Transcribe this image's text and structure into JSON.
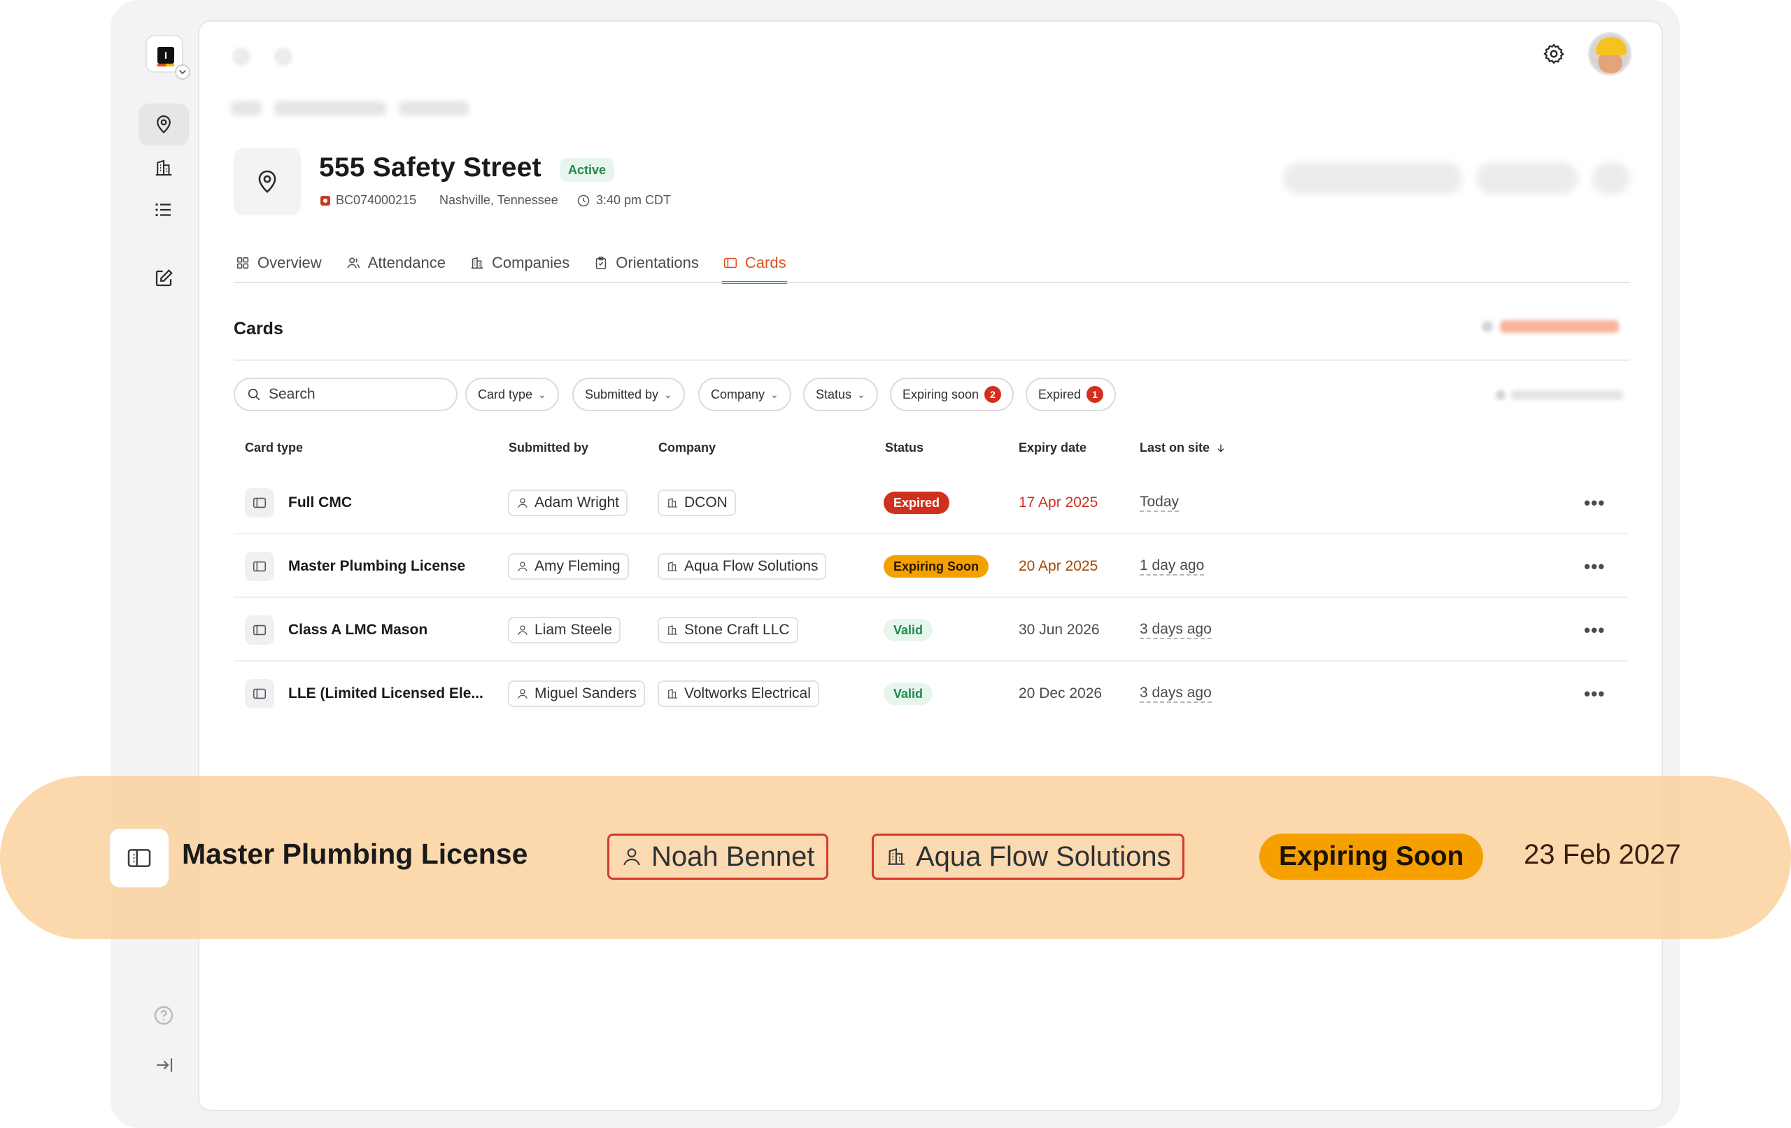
{
  "site": {
    "title": "555 Safety Street",
    "status": "Active",
    "code": "BC074000215",
    "location": "Nashville, Tennessee",
    "time": "3:40 pm CDT"
  },
  "tabs": [
    {
      "label": "Overview",
      "icon": "grid-icon"
    },
    {
      "label": "Attendance",
      "icon": "user-icon"
    },
    {
      "label": "Companies",
      "icon": "building-icon"
    },
    {
      "label": "Orientations",
      "icon": "clipboard-icon"
    },
    {
      "label": "Cards",
      "icon": "card-icon",
      "active": true
    }
  ],
  "section": {
    "title": "Cards"
  },
  "search": {
    "placeholder": "Search"
  },
  "filters": [
    {
      "label": "Card type"
    },
    {
      "label": "Submitted by"
    },
    {
      "label": "Company"
    },
    {
      "label": "Status"
    },
    {
      "label": "Expiring soon",
      "count": "2"
    },
    {
      "label": "Expired",
      "count": "1"
    }
  ],
  "table": {
    "headers": [
      "Card type",
      "Submitted by",
      "Company",
      "Status",
      "Expiry date",
      "Last on site"
    ],
    "rows": [
      {
        "card": "Full CMC",
        "submitted_by": "Adam Wright",
        "company": "DCON",
        "status": "Expired",
        "expiry": "17 Apr 2025",
        "last_on_site": "Today"
      },
      {
        "card": "Master Plumbing License",
        "submitted_by": "Amy Fleming",
        "company": "Aqua Flow Solutions",
        "status": "Expiring Soon",
        "expiry": "20 Apr 2025",
        "last_on_site": "1 day ago"
      },
      {
        "card": "Class A LMC Mason",
        "submitted_by": "Liam Steele",
        "company": "Stone Craft LLC",
        "status": "Valid",
        "expiry": "30 Jun 2026",
        "last_on_site": "3 days ago"
      },
      {
        "card": "LLE (Limited Licensed Ele...",
        "submitted_by": "Miguel Sanders",
        "company": "Voltworks Electrical",
        "status": "Valid",
        "expiry": "20 Dec 2026",
        "last_on_site": "3 days ago"
      }
    ]
  },
  "highlight": {
    "card": "Master Plumbing License",
    "submitted_by": "Noah Bennet",
    "company": "Aqua Flow Solutions",
    "status": "Expiring Soon",
    "expiry": "23 Feb 2027"
  },
  "colors": {
    "accent": "#e2511f",
    "expired": "#d0301f",
    "expiring": "#f4a100",
    "valid": "#1f8a4c",
    "band": "#facf96"
  }
}
